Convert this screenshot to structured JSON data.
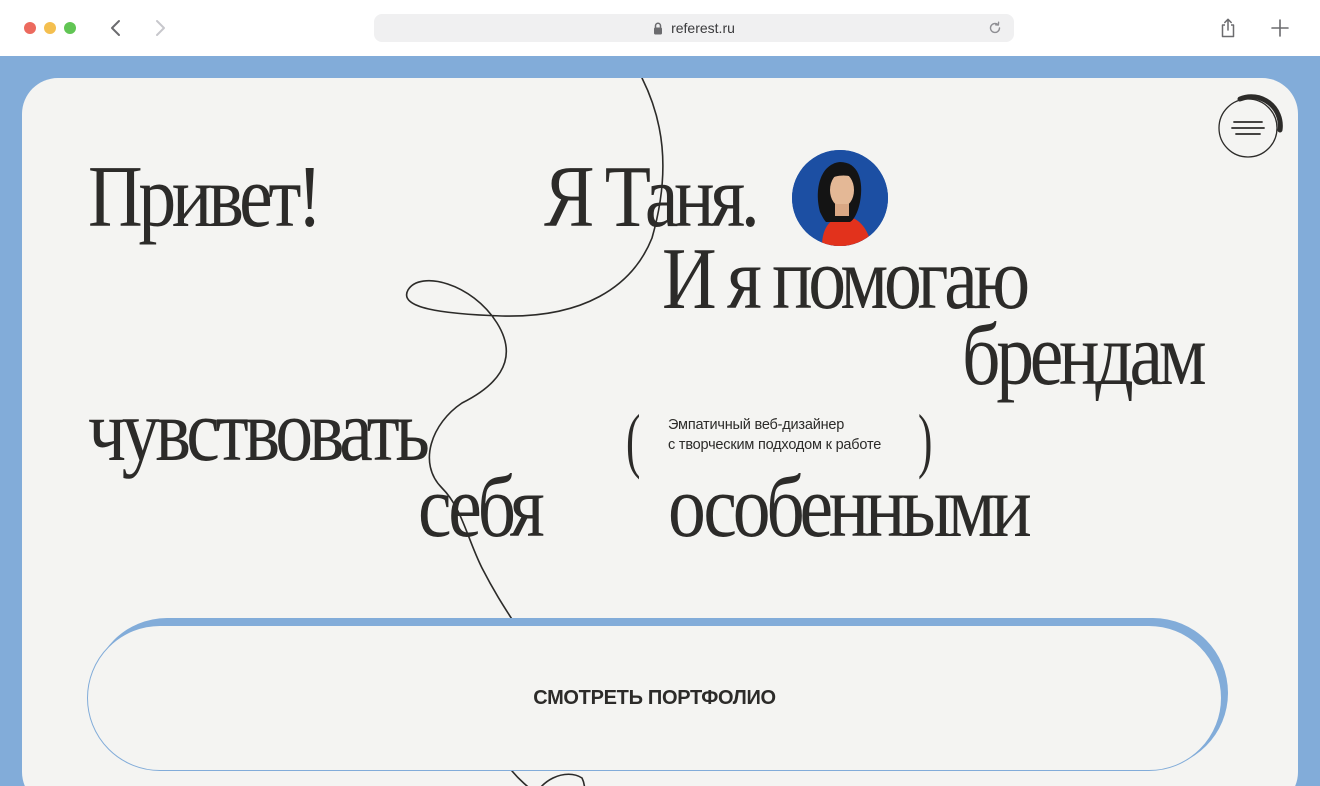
{
  "browser": {
    "url": "referest.ru",
    "icons": {
      "back": "chevron-left-icon",
      "forward": "chevron-right-icon",
      "lock": "lock-icon",
      "reload": "reload-icon",
      "share": "share-icon",
      "new_tab": "plus-icon"
    }
  },
  "colors": {
    "frame_blue": "#82acd9",
    "card_bg": "#f4f4f2",
    "text_dark": "#2c2b29",
    "avatar_bg": "#1c4fa3",
    "sweater_red": "#e2321c"
  },
  "hero": {
    "line_privet": "Привет!",
    "line_ya_tanya": "Я Таня.",
    "line_i_ya": "И я помогаю",
    "line_brendam": "брендам",
    "line_chuvstvovat": "чувствовать",
    "line_sebya": "себя",
    "line_osobennymi": "особенными",
    "paren_open": "(",
    "paren_close": ")",
    "tagline_line1": "Эмпатичный веб-дизайнер",
    "tagline_line2": "с творческим подходом к работе"
  },
  "cta": {
    "label": "СМОТРЕТЬ ПОРТФОЛИО"
  },
  "menu": {
    "icon": "hamburger-menu-icon"
  }
}
